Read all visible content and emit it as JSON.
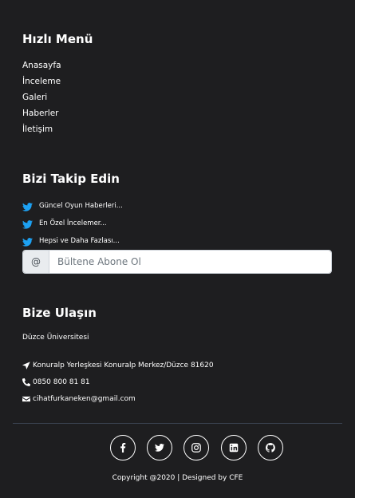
{
  "quick_menu": {
    "title": "Hızlı Menü",
    "links": [
      "Anasayfa",
      "İnceleme",
      "Galeri",
      "Haberler",
      "İletişim"
    ]
  },
  "follow": {
    "title": "Bizi Takip Edin",
    "items": [
      "Güncel Oyun Haberleri...",
      "En Özel İncelemer...",
      "Hepsi ve Daha Fazlası..."
    ],
    "newsletter_prefix": "@",
    "newsletter_placeholder": "Bültene Abone Ol"
  },
  "contact": {
    "title": "Bize Ulaşın",
    "university": "Düzce Üniversitesi",
    "address": "Konuralp Yerleşkesi Konuralp Merkez/Düzce 81620",
    "phone": "0850 800 81 81",
    "email": "cihatfurkaneken@gmail.com"
  },
  "social_icons": [
    "facebook-icon",
    "twitter-icon",
    "instagram-icon",
    "linkedin-icon",
    "github-icon"
  ],
  "copyright": "Copyright @2020 | Designed by CFE",
  "colors": {
    "footer_bg": "#1e1e20",
    "twitter_blue": "#1da1f2"
  }
}
